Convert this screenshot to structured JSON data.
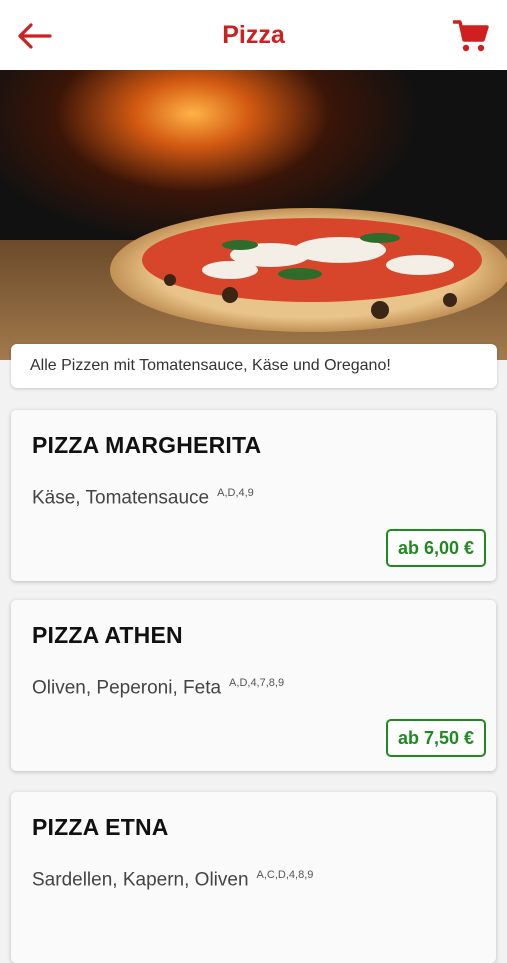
{
  "header": {
    "title": "Pizza",
    "back_icon": "arrow-left-icon",
    "cart_icon": "shopping-cart-icon"
  },
  "colors": {
    "accent": "#d01f1f",
    "price": "#1f8a1f"
  },
  "category_note": "Alle Pizzen mit Tomatensauce, Käse und Oregano!",
  "items": [
    {
      "name": "PIZZA MARGHERITA",
      "description": "Käse, Tomatensauce",
      "allergens": "A,D,4,9",
      "price": "ab 6,00 €"
    },
    {
      "name": "PIZZA ATHEN",
      "description": "Oliven, Peperoni, Feta",
      "allergens": "A,D,4,7,8,9",
      "price": "ab 7,50 €"
    },
    {
      "name": "PIZZA ETNA",
      "description": "Sardellen, Kapern, Oliven",
      "allergens": "A,C,D,4,8,9",
      "price": ""
    }
  ]
}
